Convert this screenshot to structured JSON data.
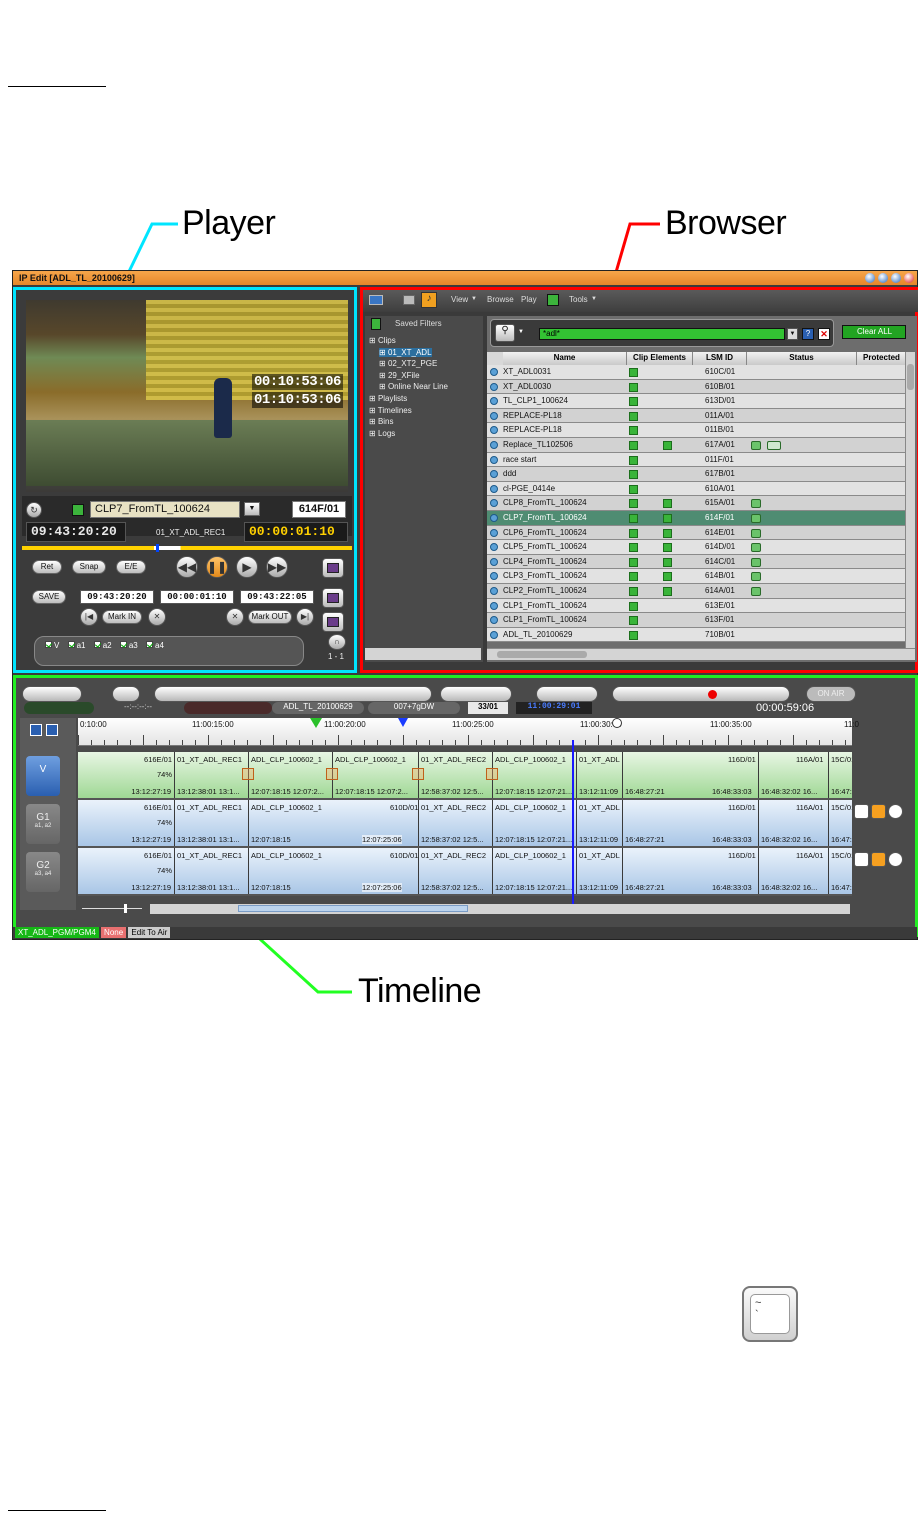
{
  "callouts": {
    "player": "Player",
    "browser": "Browser",
    "timeline": "Timeline"
  },
  "window": {
    "title": "IP Edit [ADL_TL_20100629]"
  },
  "player": {
    "overlay_tc1": "00:10:53:06",
    "overlay_tc2": "01:10:53:06",
    "clip_name": "CLP7_FromTL_100624",
    "lsm_id": "614F/01",
    "timecode": "09:43:20:20",
    "record_train": "01_XT_ADL_REC1",
    "duration": "00:00:01:10",
    "btn_ret": "Ret",
    "btn_snap": "Snap",
    "btn_ee": "E/E",
    "btn_save": "SAVE",
    "tc_in": "09:43:20:20",
    "tc_dur": "00:00:01:10",
    "tc_out": "09:43:22:05",
    "mark_in": "Mark IN",
    "mark_out": "Mark OUT",
    "channels": [
      "V",
      "a1",
      "a2",
      "a3",
      "a4"
    ],
    "audio_mode": "1 - 1"
  },
  "browser": {
    "toolbar": {
      "view": "View",
      "browse": "Browse",
      "play": "Play",
      "tools": "Tools"
    },
    "saved_filters": "Saved Filters",
    "tree": [
      {
        "label": "Clips",
        "level": 0
      },
      {
        "label": "01_XT_ADL",
        "level": 1,
        "selected": true
      },
      {
        "label": "02_XT2_PGE",
        "level": 1
      },
      {
        "label": "29_XFile",
        "level": 1
      },
      {
        "label": "Online Near Line",
        "level": 1
      },
      {
        "label": "Playlists",
        "level": 0
      },
      {
        "label": "Timelines",
        "level": 0
      },
      {
        "label": "Bins",
        "level": 0
      },
      {
        "label": "Logs",
        "level": 0
      }
    ],
    "search_value": "*adl*",
    "clear_all": "Clear ALL",
    "columns": [
      "Name",
      "Clip Elements",
      "LSM ID",
      "Status",
      "Protected"
    ],
    "rows": [
      {
        "name": "XT_ADL0031",
        "id": "610C/01",
        "ce2": false,
        "status": 0
      },
      {
        "name": "XT_ADL0030",
        "id": "610B/01",
        "ce2": false,
        "status": 0
      },
      {
        "name": "TL_CLP1_100624",
        "id": "613D/01",
        "ce2": false,
        "status": 0
      },
      {
        "name": "REPLACE-PL18",
        "id": "011A/01",
        "ce2": false,
        "status": 0
      },
      {
        "name": "REPLACE-PL18",
        "id": "011B/01",
        "ce2": false,
        "status": 0
      },
      {
        "name": "Replace_TL102506",
        "id": "617A/01",
        "ce2": true,
        "status": 2
      },
      {
        "name": "race start",
        "id": "011F/01",
        "ce2": false,
        "status": 0
      },
      {
        "name": "ddd",
        "id": "617B/01",
        "ce2": false,
        "status": 0
      },
      {
        "name": "cl-PGE_0414e",
        "id": "610A/01",
        "ce2": false,
        "status": 0
      },
      {
        "name": "CLP8_FromTL_100624",
        "id": "615A/01",
        "ce2": true,
        "status": 1
      },
      {
        "name": "CLP7_FromTL_100624",
        "id": "614F/01",
        "ce2": true,
        "status": 1,
        "selected": true
      },
      {
        "name": "CLP6_FromTL_100624",
        "id": "614E/01",
        "ce2": true,
        "status": 1
      },
      {
        "name": "CLP5_FromTL_100624",
        "id": "614D/01",
        "ce2": true,
        "status": 1
      },
      {
        "name": "CLP4_FromTL_100624",
        "id": "614C/01",
        "ce2": true,
        "status": 1
      },
      {
        "name": "CLP3_FromTL_100624",
        "id": "614B/01",
        "ce2": true,
        "status": 1
      },
      {
        "name": "CLP2_FromTL_100624",
        "id": "614A/01",
        "ce2": true,
        "status": 1
      },
      {
        "name": "CLP1_FromTL_100624",
        "id": "613E/01",
        "ce2": false,
        "status": 0
      },
      {
        "name": "CLP1_FromTL_100624",
        "id": "613F/01",
        "ce2": false,
        "status": 0
      },
      {
        "name": "ADL_TL_20100629",
        "id": "710B/01",
        "ce2": false,
        "status": 0
      }
    ]
  },
  "timeline": {
    "on_air": "ON AIR",
    "status_dashes": "--:--:--:--",
    "name": "ADL_TL_20100629",
    "id_field": "007+7gDW",
    "page": "33/01",
    "tc": "11:00:29:01",
    "duration": "00:00:59:06",
    "ruler": [
      "0:10:00",
      "11:00:15:00",
      "11:00:20:00",
      "11:00:25:00",
      "11:00:30:00",
      "11:00:35:00",
      "11:0"
    ],
    "tracks": [
      {
        "label": "V",
        "sub": "",
        "type": "v"
      },
      {
        "label": "G1",
        "sub": "a1, a2",
        "type": "a"
      },
      {
        "label": "G2",
        "sub": "a3, a4",
        "type": "a"
      }
    ],
    "percent": "74%",
    "segments_v": [
      {
        "top": "01_XT_ADL_REC1",
        "bottom": "13:12:38:01 13:1..."
      },
      {
        "top": "ADL_CLP_100602_1",
        "bottom": "12:07:18:15 12:07:2..."
      },
      {
        "top": "ADL_CLP_100602_1",
        "bottom": "12:07:18:15 12:07:2..."
      },
      {
        "top": "01_XT_ADL_REC2",
        "bottom": "12:58:37:02 12:5..."
      },
      {
        "top": "ADL_CLP_100602_1",
        "bottom": "12:07:18:15 12:07:21..."
      },
      {
        "top": "01_XT_ADL",
        "bottom": "13:12:11:09"
      },
      {
        "top": "",
        "bottom": "16:48:27:21"
      },
      {
        "top": "",
        "bottom": "16:48:32:02 16..."
      },
      {
        "top": "15C/01",
        "bottom": "16:47:"
      }
    ],
    "segments_a": [
      {
        "top": "01_XT_ADL_REC1",
        "bottom": "13:12:38:01 13:1..."
      },
      {
        "top": "ADL_CLP_100602_1",
        "bottom": "12:07:18:15"
      },
      {
        "top": "01_XT_ADL_REC2",
        "bottom": "12:58:37:02 12:5..."
      },
      {
        "top": "ADL_CLP_100602_1",
        "bottom": "12:07:18:15 12:07:21..."
      },
      {
        "top": "01_XT_ADL",
        "bottom": "13:12:11:09"
      },
      {
        "top": "",
        "bottom": "16:48:27:21"
      },
      {
        "top": "",
        "bottom": "16:48:32:02 16..."
      },
      {
        "top": "15C/01",
        "bottom": "16:47:"
      }
    ],
    "first_seg": {
      "id": "616E/01",
      "start": "13:12:27:19"
    },
    "a_extra": {
      "id": "610D/01",
      "end": "12:07:25:06"
    },
    "right_ids": {
      "r1": "116D/01",
      "r2": "116A/01",
      "t1": "16:48:33:03"
    },
    "status_bar": [
      "XT_ADL_PGM/PGM4",
      "None",
      "Edit To Air"
    ]
  }
}
